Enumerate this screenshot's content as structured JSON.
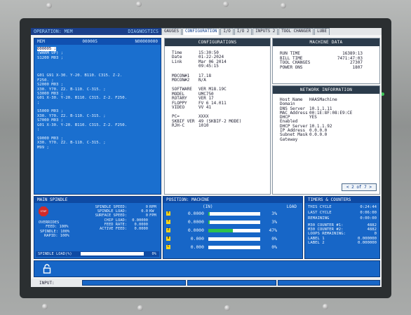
{
  "header": {
    "mode": "OPERATION: MEM",
    "title": "DIAGNOSTICS"
  },
  "tabs": [
    "GAUGES",
    "CONFIGURATION",
    "I/O",
    "I/O 2",
    "INPUTS 2",
    "TOOL CHANGER",
    "LUBE"
  ],
  "program": {
    "label": "MEM",
    "number": "000005",
    "file": "N00000000",
    "lines": [
      "O00005 ;",
      "(WARM UP) ;",
      "S1200 M03 ;",
      "",
      "",
      "",
      "G01 G91 X-30. Y-20. B110. C315. Z-2.",
      "F250. ;",
      "S2000 M03 ;",
      "X30. Y70. Z2. B-110. C-315. ;",
      "S3000 M03 ;",
      "G01 X-30. Y-20. B110. C315. Z-2. F250.",
      ";",
      "",
      "S5000 M03 ;",
      "X30. Y70. Z2. B-110. C-315. ;",
      "S7000 M03 ;",
      "G01 X-30. Y-20. B110. C315. Z-2. F250.",
      ";",
      "",
      "S9000 M03 ;",
      "X30. Y70. Z2. B-110. C-315. ;",
      "M99 ;"
    ]
  },
  "configuration": {
    "title": "CONFIGURATIONS",
    "time": {
      "label": "Time",
      "value": "15:30:50"
    },
    "date": {
      "label": "Date",
      "value": "01-22-2024"
    },
    "link": {
      "label": "Link",
      "value": "Mar 06 2014",
      "value2": "09:45:15"
    },
    "mocon1": {
      "label": "MOCON#1",
      "value": "17.18"
    },
    "mocon2": {
      "label": "MOCON#2",
      "value": "N/A"
    },
    "software": {
      "label": "SOFTWARE",
      "value": "VER M18.19C"
    },
    "model": {
      "label": "MODEL",
      "value": "UMC750"
    },
    "rotary": {
      "label": "ROTARY",
      "value": "VER 17"
    },
    "floppy": {
      "label": "FLOPPY",
      "value": "FV 6  14.011"
    },
    "video": {
      "label": "VIDEO",
      "value": "VV  41"
    },
    "pc": {
      "label": "PC=",
      "value": "XXXX"
    },
    "skbif": {
      "label": "SKBIF VER",
      "value": "49 (SKBIF-2 MODE)"
    },
    "rjh": {
      "label": "RJH-C",
      "value": "1010"
    }
  },
  "machine_data": {
    "title": "MACHINE DATA",
    "rows": [
      {
        "label": "RUN TIME",
        "value": "16389:13"
      },
      {
        "label": "BILL TIME",
        "value": "7471:47:03"
      },
      {
        "label": "TOOL CHANGES",
        "value": "27307"
      },
      {
        "label": "POWER ONS",
        "value": "1807"
      }
    ]
  },
  "network": {
    "title": "NETWORK INFORMATION",
    "rows": [
      {
        "label": "Host Name",
        "value": "HAASMachine"
      },
      {
        "label": "Domain",
        "value": ""
      },
      {
        "label": "DNS Server",
        "value": "10.1.1.11"
      },
      {
        "label": "MAC Address",
        "value": "00:1E:8F:08:E9:CE"
      },
      {
        "label": "DHCP Enabled",
        "value": "YES"
      },
      {
        "label": "DHCP Server",
        "value": "10.1.1.92"
      },
      {
        "label": "IP Address",
        "value": "0.0.0.0"
      },
      {
        "label": "Subnet Mask",
        "value": "0.0.0.0"
      },
      {
        "label": "Gateway",
        "value": ""
      }
    ],
    "pager": "< 2 of 7 >"
  },
  "spindle": {
    "title": "MAIN SPINDLE",
    "stop": "STOP",
    "speed": {
      "label": "SPINDLE SPEED:",
      "value": "0",
      "unit": "RPM"
    },
    "sload": {
      "label": "SPINDLE LOAD:",
      "value": "0.0",
      "unit": "KW"
    },
    "surface": {
      "label": "SURFACE SPEED:",
      "value": "0",
      "unit": "FPM"
    },
    "chip": {
      "label": "CHIP LOAD:",
      "value": "0.00000"
    },
    "feed": {
      "label": "FEED RATE:",
      "value": "0.0000"
    },
    "active": {
      "label": "ACTIVE FEED:",
      "value": "0.0000"
    },
    "overrides": {
      "label": "OVERRIDES",
      "feed": "FEED: 100%",
      "spindle": "SPINDLE: 100%",
      "rapid": "RAPID: 100%"
    },
    "load": {
      "label": "SPINDLE LOAD(%)",
      "value": "0%"
    }
  },
  "position": {
    "title": "POSITION: MACHINE",
    "unit": "(IN)",
    "load_label": "LOAD",
    "rows": [
      {
        "axis": "X",
        "value": "0.0000",
        "load": "3%",
        "level": 0.03
      },
      {
        "axis": "Y",
        "value": "0.0000",
        "load": "3%",
        "level": 0.03
      },
      {
        "axis": "Z",
        "value": "0.0000",
        "load": "47%",
        "level": 0.47
      },
      {
        "axis": "B",
        "value": "0.000",
        "load": "0%",
        "level": 0.0
      },
      {
        "axis": "C",
        "value": "0.000",
        "load": "0%",
        "level": 0.0
      }
    ]
  },
  "timers": {
    "title": "TIMERS & COUNTERS",
    "rows": [
      {
        "label": "THIS CYCLE",
        "value": "0:24:44"
      },
      {
        "label": "LAST CYCLE",
        "value": "0:06:00"
      },
      {
        "label": "REMAINING",
        "value": "0:00:00"
      }
    ],
    "counters": [
      {
        "label": "M30 COUNTER #1:",
        "value": "4882"
      },
      {
        "label": "M30 COUNTER #2:",
        "value": "4882"
      },
      {
        "label": "LOOPS REMAINING:",
        "value": "0"
      },
      {
        "label": "LABEL 1",
        "value": "0.000000"
      },
      {
        "label": "LABEL 2",
        "value": "0.000000"
      }
    ]
  },
  "input": {
    "label": "INPUT:"
  }
}
